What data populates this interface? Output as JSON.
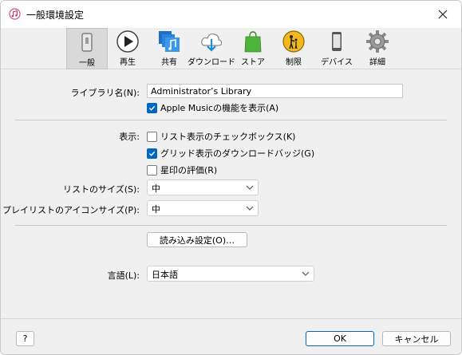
{
  "window": {
    "title": "一般環境設定"
  },
  "toolbar": {
    "items": [
      {
        "label": "一般",
        "icon": "phone-icon"
      },
      {
        "label": "再生",
        "icon": "play-icon"
      },
      {
        "label": "共有",
        "icon": "shared-music-icon"
      },
      {
        "label": "ダウンロード",
        "icon": "cloud-download-icon"
      },
      {
        "label": "ストア",
        "icon": "store-bag-icon"
      },
      {
        "label": "制限",
        "icon": "parental-restriction-icon"
      },
      {
        "label": "デバイス",
        "icon": "device-icon"
      },
      {
        "label": "詳細",
        "icon": "gear-icon"
      }
    ],
    "selected": "一般"
  },
  "general": {
    "library_name_label": "ライブラリ名(N):",
    "library_name_value": "Administrator’s Library",
    "apple_music_label": "Apple Musicの機能を表示(A)",
    "apple_music_checked": true,
    "display_label": "表示:",
    "list_checkbox_label": "リスト表示のチェックボックス(K)",
    "list_checkbox_checked": false,
    "grid_badge_label": "グリッド表示のダウンロードバッジ(G)",
    "grid_badge_checked": true,
    "star_rating_label": "星印の評価(R)",
    "star_rating_checked": false,
    "list_size_label": "リストのサイズ(S):",
    "list_size_value": "中",
    "playlist_icon_size_label": "プレイリストのアイコンサイズ(P):",
    "playlist_icon_size_value": "中",
    "import_settings_label": "読み込み設定(O)…",
    "language_label": "言語(L):",
    "language_value": "日本語"
  },
  "footer": {
    "help_label": "?",
    "ok_label": "OK",
    "cancel_label": "キャンセル"
  },
  "colors": {
    "accent": "#0067c0",
    "background": "#f0f0f0"
  }
}
